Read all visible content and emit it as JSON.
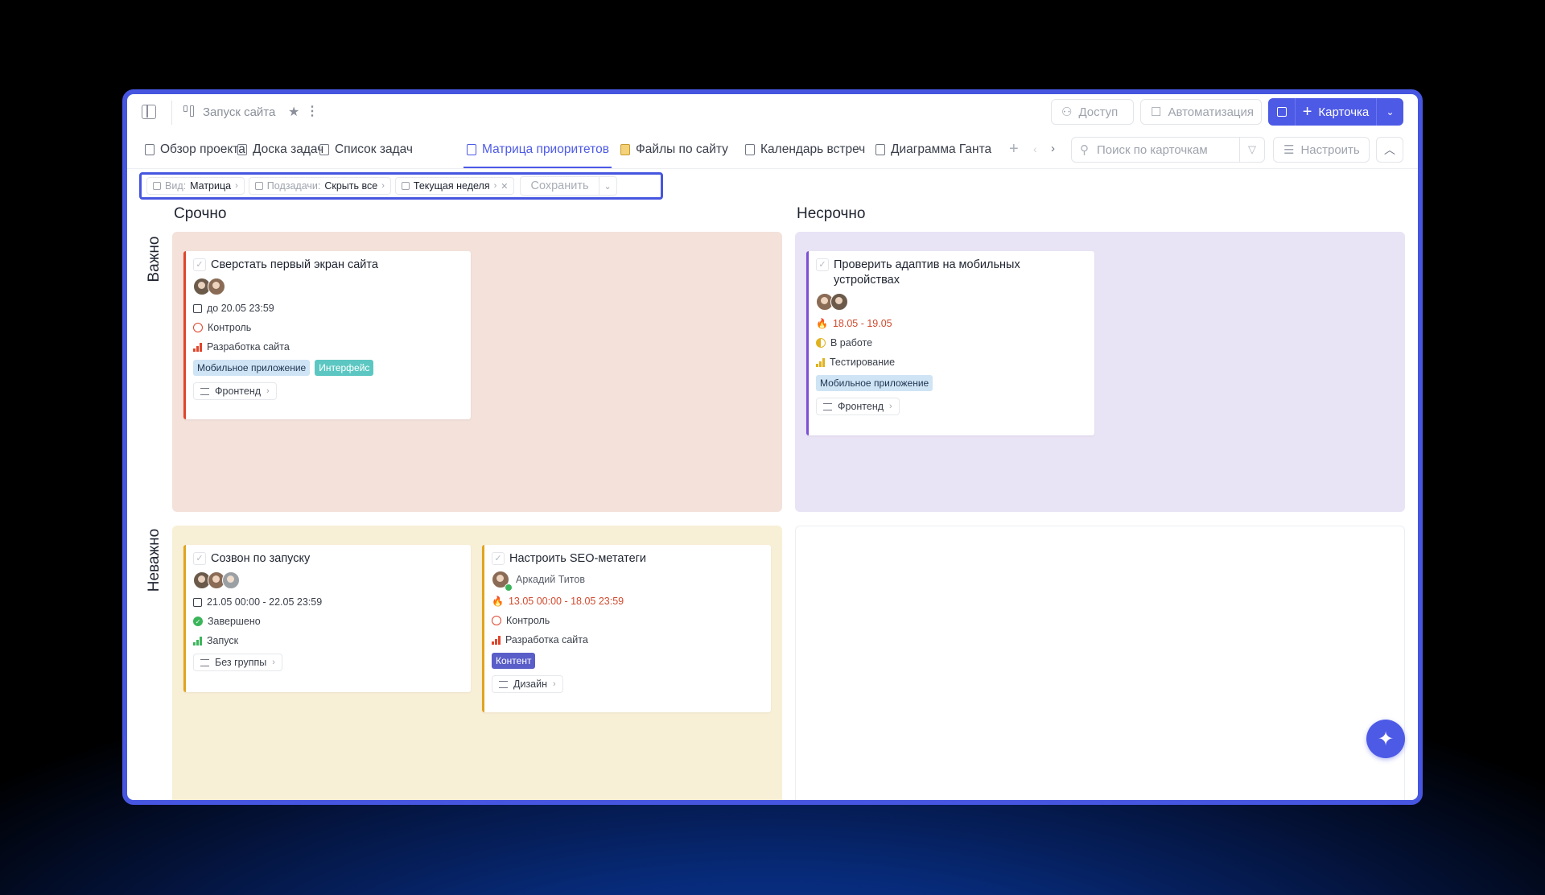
{
  "project": {
    "title": "Запуск сайта"
  },
  "toolbar": {
    "access_label": "Доступ",
    "automation_label": "Автоматизация",
    "card_label": "Карточка"
  },
  "tabs": [
    {
      "label": "Обзор проекта"
    },
    {
      "label": "Доска задач"
    },
    {
      "label": "Список задач"
    },
    {
      "label": "Матрица приоритетов",
      "active": true
    },
    {
      "label": "Файлы по сайту"
    },
    {
      "label": "Календарь встреч"
    },
    {
      "label": "Диаграмма Ганта"
    }
  ],
  "search": {
    "placeholder": "Поиск по карточкам"
  },
  "configure_label": "Настроить",
  "filters": {
    "view_label": "Вид:",
    "view_value": "Матрица",
    "subtasks_label": "Подзадачи:",
    "subtasks_value": "Скрыть все",
    "period_value": "Текущая неделя",
    "save_label": "Сохранить"
  },
  "matrix": {
    "col_urgent": "Срочно",
    "col_not_urgent": "Несрочно",
    "row_important": "Важно",
    "row_not_important": "Неважно"
  },
  "cards": {
    "c1": {
      "title": "Сверстать первый экран сайта",
      "date": "до 20.05 23:59",
      "status": "Контроль",
      "stage": "Разработка сайта",
      "tags": [
        "Мобильное приложение",
        "Интерфейс"
      ],
      "group": "Фронтенд"
    },
    "c2": {
      "title": "Проверить адаптив на мобильных устройствах",
      "date": "18.05 - 19.05",
      "status": "В работе",
      "stage": "Тестирование",
      "tags": [
        "Мобильное приложение"
      ],
      "group": "Фронтенд"
    },
    "c3": {
      "title": "Созвон по запуску",
      "date": "21.05 00:00 - 22.05 23:59",
      "status": "Завершено",
      "stage": "Запуск",
      "group": "Без группы"
    },
    "c4": {
      "title": "Настроить SEO-метатеги",
      "assignee": "Аркадий Титов",
      "date": "13.05 00:00 - 18.05 23:59",
      "status": "Контроль",
      "stage": "Разработка сайта",
      "tags": [
        "Контент"
      ],
      "group": "Дизайн"
    }
  },
  "colors": {
    "accent": "#4d5ae6",
    "urgent_important": "#f3e1da",
    "not_urgent_important": "#e8e3f5",
    "urgent_not_important": "#f8efd7"
  }
}
